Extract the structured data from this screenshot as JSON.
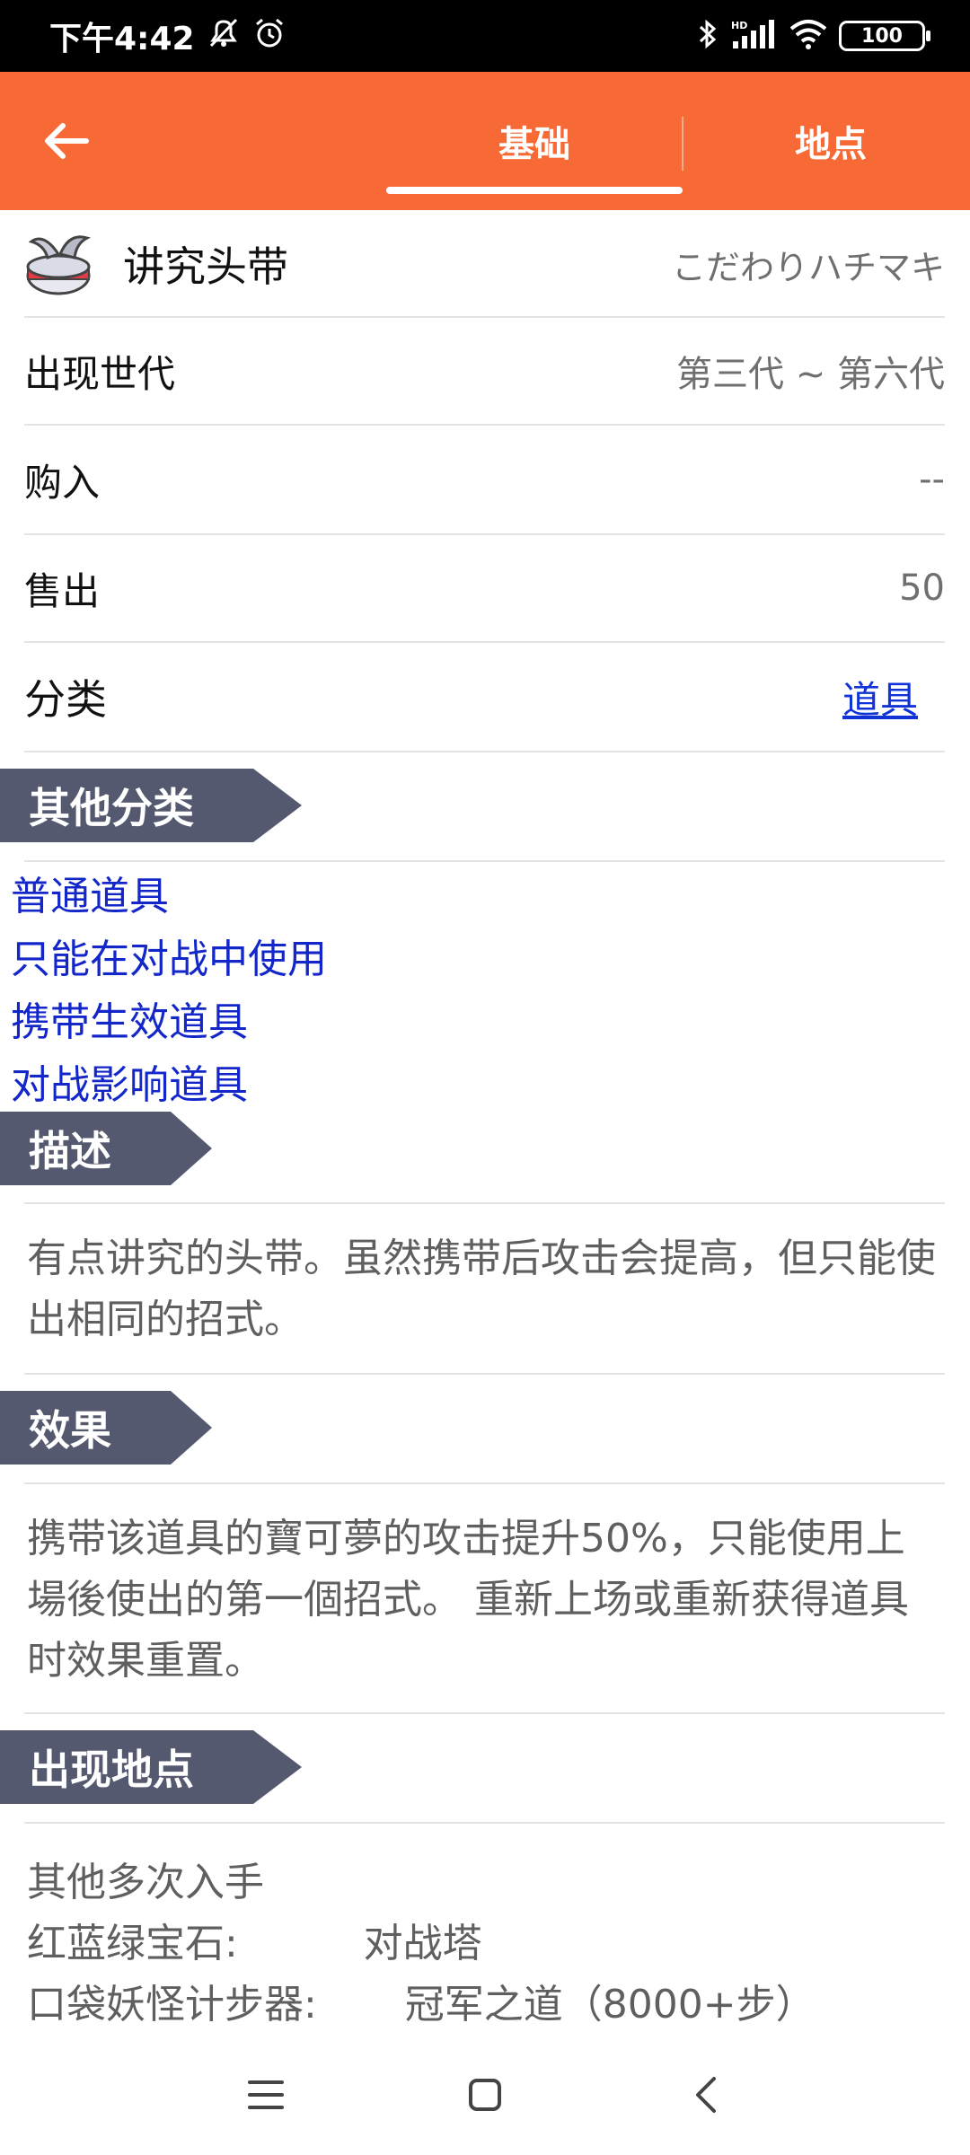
{
  "status_bar": {
    "time": "下午4:42",
    "icons_left": [
      "mute-alert-icon",
      "alarm-icon"
    ],
    "icons_right": [
      "bluetooth-icon",
      "hd-signal-icon",
      "wifi-icon"
    ],
    "battery": "100"
  },
  "header": {
    "tabs": [
      {
        "label": "基础",
        "active": true
      },
      {
        "label": "地点",
        "active": false
      }
    ],
    "accent_color": "#f86a35"
  },
  "item": {
    "name": "讲究头带",
    "japanese_name": "こだわりハチマキ"
  },
  "details": [
    {
      "label": "出现世代",
      "value": "第三代 ~ 第六代"
    },
    {
      "label": "购入",
      "value": "--"
    },
    {
      "label": "售出",
      "value": "50"
    }
  ],
  "category": {
    "label": "分类",
    "value": "道具"
  },
  "sections": {
    "other_categories": "其他分类",
    "description": "描述",
    "effect": "效果",
    "locations": "出现地点"
  },
  "other_categories": [
    "普通道具",
    "只能在对战中使用",
    "携带生效道具",
    "对战影响道具"
  ],
  "description_text": "有点讲究的头带。虽然携带后攻击会提高，但只能使出相同的招式。",
  "effect_text": "携带该道具的寶可夢的攻击提升50%，只能使用上場後使出的第一個招式。 重新上场或重新获得道具时效果重置。",
  "locations": [
    "其他多次入手",
    "红蓝绿宝石:          对战塔",
    "口袋妖怪计步器:       冠军之道（8000+步）"
  ]
}
